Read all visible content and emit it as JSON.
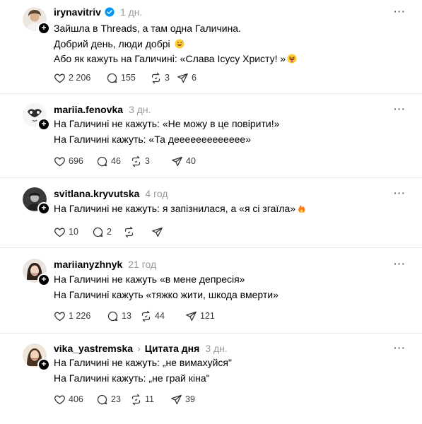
{
  "posts": [
    {
      "username": "irynavitriv",
      "time": "1 дн.",
      "verified": true,
      "lines": [
        "Зайшла в Threads, а там одна Галичина.",
        "Добрий день, люди добрі",
        "Або як кажуть на Галичині: «Слава Ісусу Христу! »"
      ],
      "likes": "2 206",
      "replies": "155",
      "reposts": "3",
      "shares": "6"
    },
    {
      "username": "mariia.fenovka",
      "time": "3 дн.",
      "lines": [
        "На Галичині не кажуть: «Не можу в це повірити!»",
        "На Галичині кажуть: «Та деееееееееееее»"
      ],
      "likes": "696",
      "replies": "46",
      "reposts": "3",
      "shares": "40"
    },
    {
      "username": "svitlana.kryvutska",
      "time": "4 год",
      "lines": [
        "На Галичині не кажуть: я запізнилася, а «я сі згаїла»"
      ],
      "likes": "10",
      "replies": "2",
      "reposts": "",
      "shares": ""
    },
    {
      "username": "mariianyzhnyk",
      "time": "21 год",
      "lines": [
        "На Галичині не кажуть «в мене депресія»",
        "На Галичині кажуть «тяжко жити, шкода вмерти»"
      ],
      "likes": "1 226",
      "replies": "13",
      "reposts": "44",
      "shares": "121"
    },
    {
      "username": "vika_yastremska",
      "topic": "Цитата дня",
      "time": "3 дн.",
      "lines": [
        "На Галичині не кажуть: „не вимахуйся\"",
        "На Галичині кажуть: „не грай кіна\""
      ],
      "likes": "406",
      "replies": "23",
      "reposts": "11",
      "shares": "39"
    }
  ],
  "more_label": "···",
  "chevron": "›",
  "icons": {
    "like": "heart-icon",
    "reply": "comment-icon",
    "repost": "repost-icon",
    "share": "send-icon",
    "emoji_grin": "grinning-sweat-emoji",
    "emoji_tongue": "tongue-emoji",
    "emoji_fire": "fire-emoji"
  },
  "colors": {
    "text": "#000000",
    "muted": "#999999",
    "divider": "#e6e6e6",
    "verified": "#0095f6"
  }
}
